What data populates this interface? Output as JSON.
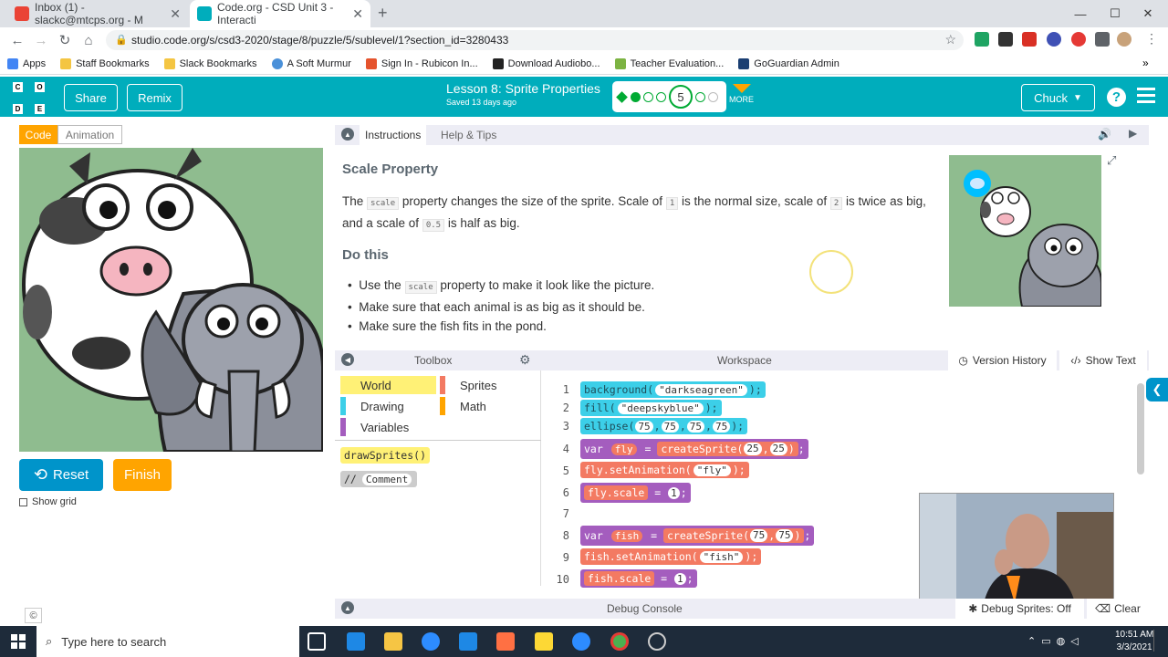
{
  "browser": {
    "tabs": [
      {
        "title": "Inbox (1) - slackc@mtcps.org - M",
        "icon": "gmail-icon"
      },
      {
        "title": "Code.org - CSD Unit 3 - Interacti",
        "icon": "codeorg-icon"
      }
    ],
    "url": "studio.code.org/s/csd3-2020/stage/8/puzzle/5/sublevel/1?section_id=3280433",
    "bookmarks": [
      "Apps",
      "Staff Bookmarks",
      "Slack Bookmarks",
      "A Soft Murmur",
      "Sign In - Rubicon In...",
      "Download Audiobo...",
      "Teacher Evaluation...",
      "GoGuardian Admin"
    ]
  },
  "header": {
    "logo_letters": [
      "C",
      "O",
      "D",
      "E"
    ],
    "share": "Share",
    "remix": "Remix",
    "lesson_title": "Lesson 8: Sprite Properties",
    "saved": "Saved 13 days ago",
    "current_puzzle": "5",
    "more": "MORE",
    "user": "Chuck"
  },
  "left": {
    "tab_code": "Code",
    "tab_animation": "Animation",
    "reset": "Reset",
    "finish": "Finish",
    "show_grid": "Show grid"
  },
  "instructions": {
    "tab_instructions": "Instructions",
    "tab_help": "Help & Tips",
    "heading": "Scale Property",
    "p1_a": "The",
    "p1_code1": "scale",
    "p1_b": "property changes the size of the sprite. Scale of",
    "p1_code2": "1",
    "p1_c": "is the normal size, scale of",
    "p1_code3": "2",
    "p1_d": "is twice",
    "p1_e": "as big, and a scale of",
    "p1_code4": "0.5",
    "p1_f": "is half as big.",
    "do_this": "Do this",
    "b1_a": "Use the",
    "b1_code": "scale",
    "b1_b": "property to make it look like the picture.",
    "b2": "Make sure that each animal is as big as it should be.",
    "b3": "Make sure the fish fits in the pond."
  },
  "toolbox": {
    "title": "Toolbox",
    "categories": [
      {
        "label": "World",
        "color": "#fff176"
      },
      {
        "label": "Sprites",
        "color": "#f37a62"
      },
      {
        "label": "Drawing",
        "color": "#3ccfe8"
      },
      {
        "label": "Math",
        "color": "#ffa400"
      },
      {
        "label": "Variables",
        "color": "#a45dbe"
      }
    ],
    "block1": "drawSprites()",
    "block2": "Comment"
  },
  "workspace": {
    "title": "Workspace",
    "version_history": "Version History",
    "show_text": "Show Text",
    "line_numbers": [
      "1",
      "2",
      "3",
      "4",
      "5",
      "6",
      "7",
      "8",
      "9",
      "10"
    ],
    "l1_fn": "background",
    "l1_arg": "\"darkseagreen\"",
    "l2_fn": "fill",
    "l2_arg": "\"deepskyblue\"",
    "l3_fn": "ellipse",
    "l3_args": [
      "75",
      "75",
      "75",
      "75"
    ],
    "l4_var": "var",
    "l4_name": "fly",
    "l4_fn": "createSprite",
    "l4_args": [
      "25",
      "25"
    ],
    "l5_name": "fly",
    "l5_fn": ".setAnimation",
    "l5_arg": "\"fly\"",
    "l6_name": "fly",
    "l6_prop": ".scale",
    "l6_val": "1",
    "l8_var": "var",
    "l8_name": "fish",
    "l8_fn": "createSprite",
    "l8_args": [
      "75",
      "75"
    ],
    "l9_name": "fish",
    "l9_fn": ".setAnimation",
    "l9_arg": "\"fish\"",
    "l10_name": "fish",
    "l10_prop": ".scale",
    "l10_val": "1"
  },
  "debug": {
    "title": "Debug Console",
    "sprites": "Debug Sprites: Off",
    "clear": "Clear"
  },
  "taskbar": {
    "search": "Type here to search",
    "time": "10:51 AM",
    "date": "3/3/2021"
  },
  "copyright": "©"
}
